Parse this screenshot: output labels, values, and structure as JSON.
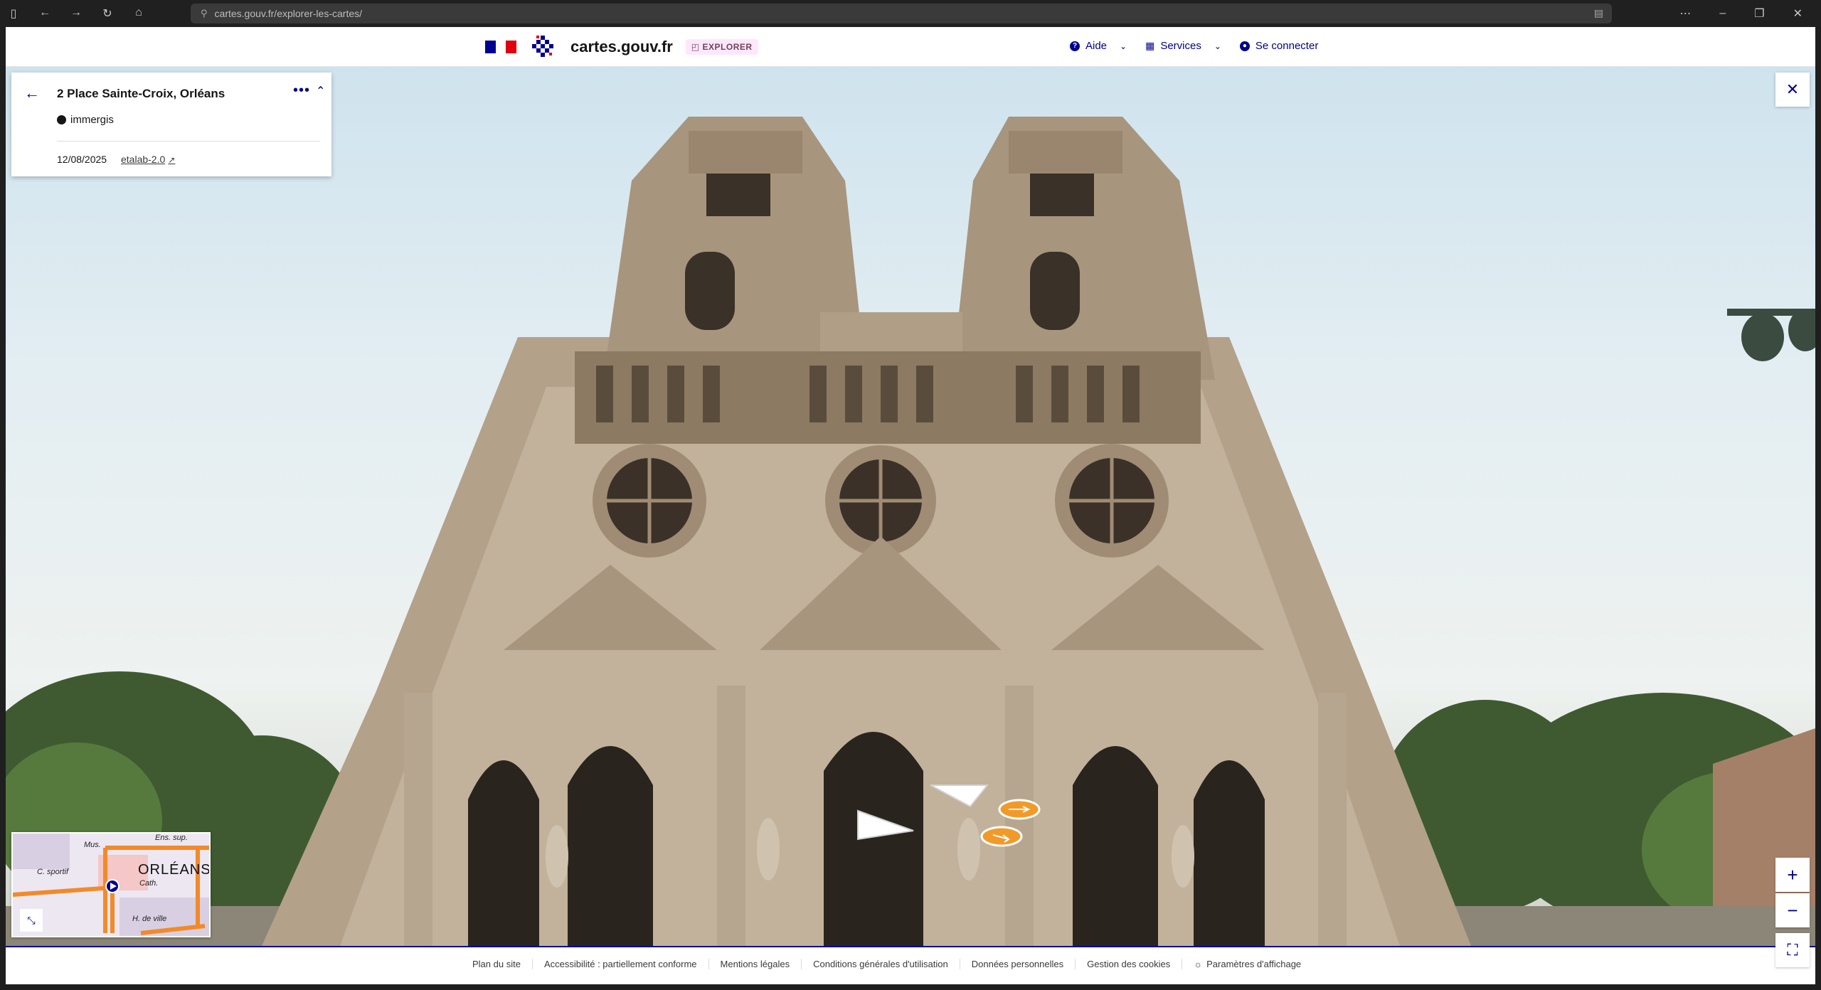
{
  "browser": {
    "url": "cartes.gouv.fr/explorer-les-cartes/"
  },
  "header": {
    "site_name": "cartes.gouv.fr",
    "badge": "EXPLORER",
    "links": [
      {
        "label": "Aide"
      },
      {
        "label": "Services"
      },
      {
        "label": "Se connecter"
      }
    ]
  },
  "info_card": {
    "address": "2 Place Sainte-Croix, Orléans",
    "author": "immergis",
    "date": "12/08/2025",
    "license": "etalab-2.0"
  },
  "minimap": {
    "city": "ORLÉANS",
    "labels": [
      "C. sportif",
      "Cath.",
      "H. de ville",
      "Mus.",
      "Ens. sup."
    ]
  },
  "footer": {
    "links": [
      "Plan du site",
      "Accessibilité : partiellement conforme",
      "Mentions légales",
      "Conditions générales d'utilisation",
      "Données personnelles",
      "Gestion des cookies",
      "Paramètres d'affichage"
    ]
  },
  "colors": {
    "brand_blue": "#000091",
    "flag_red": "#e1000f",
    "badge_bg": "#fee7fc"
  },
  "icons": {
    "back": "arrow-left-icon",
    "more": "more-icon",
    "collapse": "chevron-up-icon",
    "close": "close-icon",
    "zoom_in": "plus-icon",
    "zoom_out": "minus-icon",
    "fullscreen": "fullscreen-icon"
  }
}
